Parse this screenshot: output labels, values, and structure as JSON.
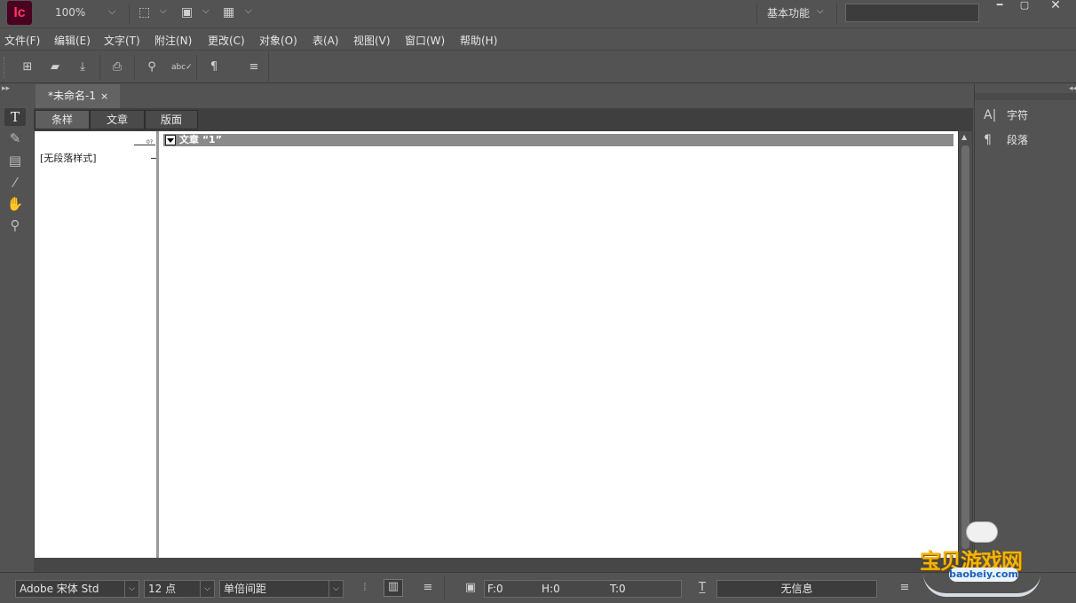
{
  "app": {
    "logo_text": "Ic",
    "zoom": "100%",
    "workspace": "基本功能"
  },
  "menu": [
    "文件(F)",
    "编辑(E)",
    "文字(T)",
    "附注(N)",
    "更改(C)",
    "对象(O)",
    "表(A)",
    "视图(V)",
    "窗口(W)",
    "帮助(H)"
  ],
  "document": {
    "tab_title": "*未命名-1",
    "close_glyph": "×"
  },
  "view_tabs": [
    "条样",
    "文章",
    "版面"
  ],
  "style_column": {
    "style_name": "[无段落样式]",
    "ruler_mark": "0?"
  },
  "story": {
    "title": "文章 “1”"
  },
  "right_panel": {
    "items": [
      {
        "label": "字符",
        "icon": "character-icon"
      },
      {
        "label": "段落",
        "icon": "paragraph-icon"
      }
    ]
  },
  "status": {
    "font": "Adobe 宋体 Std",
    "size": "12 点",
    "spacing": "单倍间距",
    "f_value": "F:0",
    "h_value": "H:0",
    "t_value": "T:0",
    "info": "无信息"
  },
  "watermark": {
    "title": "宝贝游戏网",
    "url": "baobeiy.com"
  },
  "colors": {
    "logo_bg": "#49021f",
    "logo_fg": "#ff3366",
    "ui_bg": "#535353",
    "watermark": "#f5b400"
  }
}
